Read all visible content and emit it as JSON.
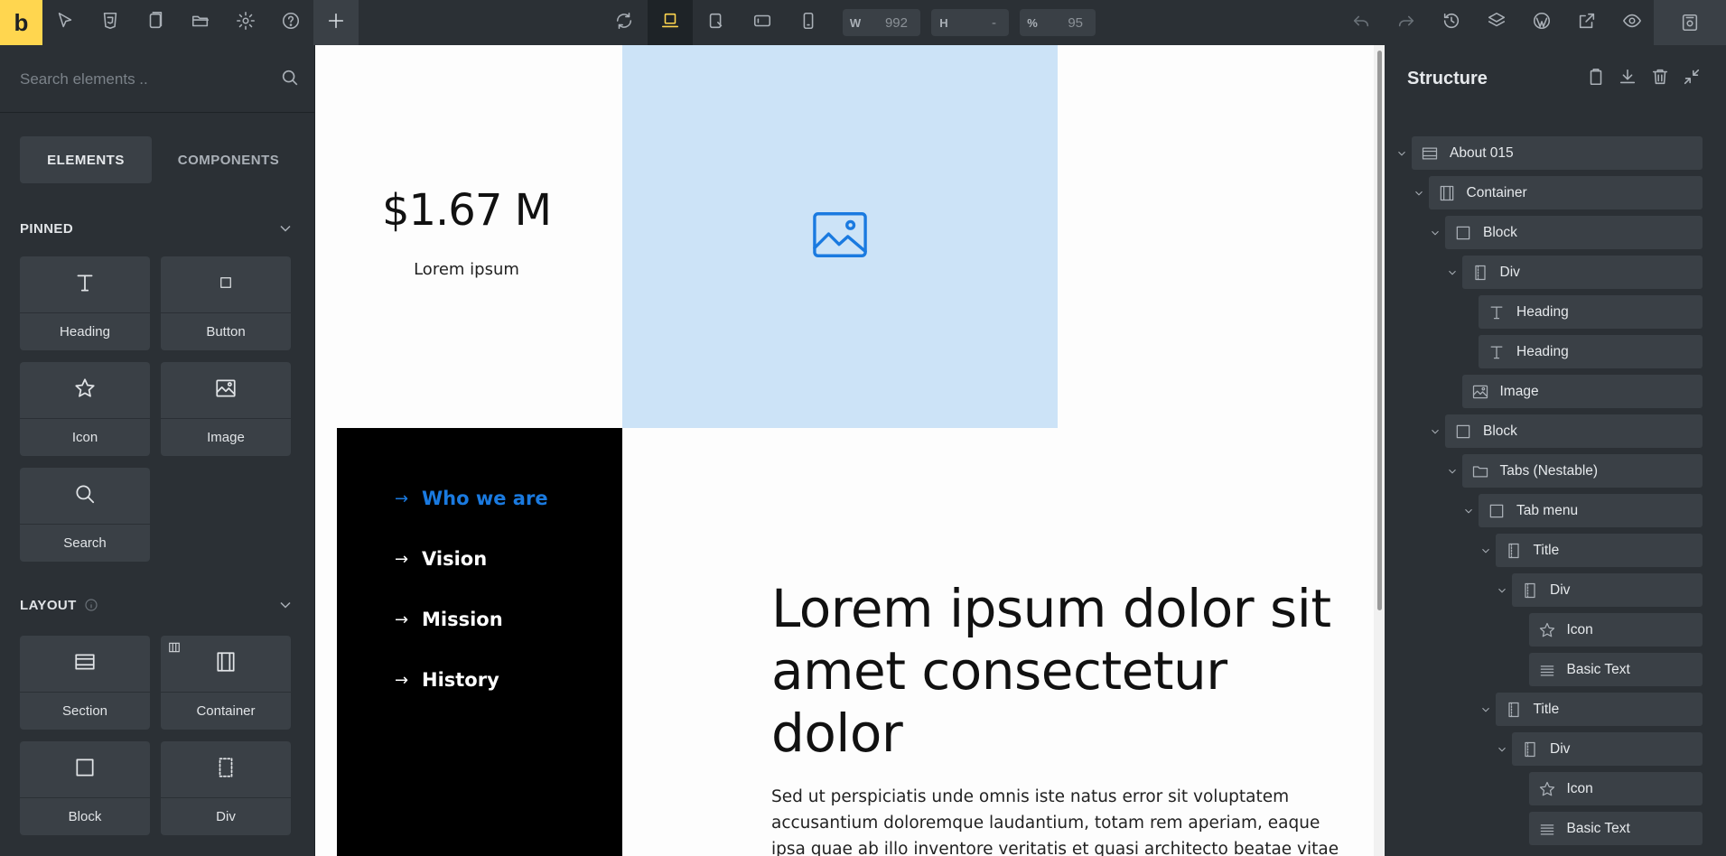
{
  "toolbar": {
    "logo_text": "b",
    "width_label": "W",
    "width_value": "992",
    "height_label": "H",
    "height_value": "-",
    "zoom_label": "%",
    "zoom_value": "95"
  },
  "left_panel": {
    "search_placeholder": "Search elements ..",
    "tabs": [
      {
        "label": "ELEMENTS",
        "active": true
      },
      {
        "label": "COMPONENTS",
        "active": false
      }
    ],
    "pinned_header": "PINNED",
    "layout_header": "LAYOUT",
    "pinned": [
      {
        "label": "Heading",
        "icon": "heading-icon"
      },
      {
        "label": "Button",
        "icon": "button-icon"
      },
      {
        "label": "Icon",
        "icon": "star-icon"
      },
      {
        "label": "Image",
        "icon": "image-icon"
      },
      {
        "label": "Search",
        "icon": "search-icon"
      }
    ],
    "layout": [
      {
        "label": "Section",
        "icon": "section-icon"
      },
      {
        "label": "Container",
        "icon": "container-icon"
      },
      {
        "label": "Block",
        "icon": "block-icon"
      },
      {
        "label": "Div",
        "icon": "div-icon"
      }
    ]
  },
  "canvas": {
    "stat_value": "$1.67 M",
    "stat_label": "Lorem ipsum",
    "tab_links": [
      {
        "label": "Who we are",
        "active": true
      },
      {
        "label": "Vision",
        "active": false
      },
      {
        "label": "Mission",
        "active": false
      },
      {
        "label": "History",
        "active": false
      }
    ],
    "heading_lines": [
      "Lorem ipsum dolor sit",
      "amet consectetur",
      "dolor"
    ],
    "body_lines": [
      "Sed ut perspiciatis unde omnis iste natus error sit voluptatem",
      "accusantium doloremque laudantium, totam rem aperiam, eaque",
      "ipsa quae ab illo inventore veritatis et quasi architecto beatae vitae"
    ],
    "accent_color": "#1a7ae0",
    "image_bg_color": "#cce3f7"
  },
  "structure": {
    "title": "Structure",
    "items": [
      {
        "label": "About 015",
        "icon": "section-icon",
        "level": 0,
        "expanded": true
      },
      {
        "label": "Container",
        "icon": "container-icon",
        "level": 1,
        "expanded": true
      },
      {
        "label": "Block",
        "icon": "block-icon",
        "level": 2,
        "expanded": true
      },
      {
        "label": "Div",
        "icon": "div-icon",
        "level": 3,
        "expanded": true
      },
      {
        "label": "Heading",
        "icon": "heading-icon",
        "level": 4,
        "expanded": false
      },
      {
        "label": "Heading",
        "icon": "heading-icon",
        "level": 4,
        "expanded": false
      },
      {
        "label": "Image",
        "icon": "image-icon",
        "level": 3,
        "expanded": false
      },
      {
        "label": "Block",
        "icon": "block-icon",
        "level": 2,
        "expanded": true
      },
      {
        "label": "Tabs (Nestable)",
        "icon": "folder-icon",
        "level": 3,
        "expanded": true
      },
      {
        "label": "Tab menu",
        "icon": "block-icon",
        "level": 4,
        "expanded": true
      },
      {
        "label": "Title",
        "icon": "div-icon",
        "level": 5,
        "expanded": true
      },
      {
        "label": "Div",
        "icon": "div-icon",
        "level": 6,
        "expanded": true
      },
      {
        "label": "Icon",
        "icon": "star-icon",
        "level": 7,
        "expanded": false
      },
      {
        "label": "Basic Text",
        "icon": "text-icon",
        "level": 7,
        "expanded": false
      },
      {
        "label": "Title",
        "icon": "div-icon",
        "level": 5,
        "expanded": true
      },
      {
        "label": "Div",
        "icon": "div-icon",
        "level": 6,
        "expanded": true
      },
      {
        "label": "Icon",
        "icon": "star-icon",
        "level": 7,
        "expanded": false
      },
      {
        "label": "Basic Text",
        "icon": "text-icon",
        "level": 7,
        "expanded": false
      }
    ]
  }
}
